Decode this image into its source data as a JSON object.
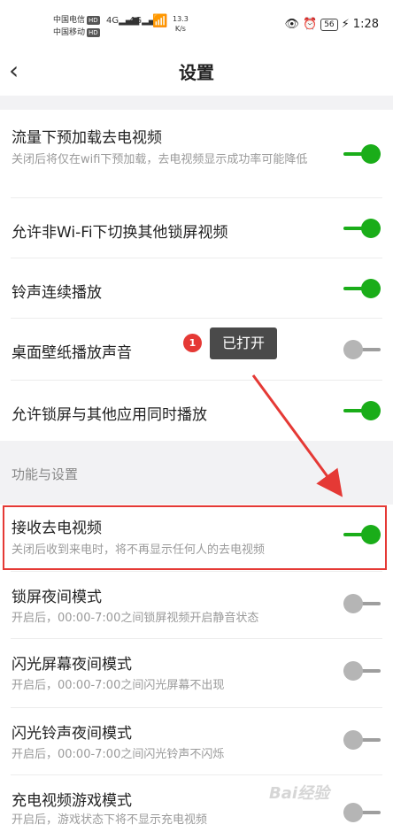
{
  "status": {
    "carrier1": "中国电信",
    "carrier2": "中国移动",
    "hd": "HD",
    "net": "4G",
    "speed_value": "13.3",
    "speed_unit": "K/s",
    "battery": "56",
    "time": "1:28"
  },
  "header": {
    "back_icon": "chevron-left-icon",
    "title": "设置"
  },
  "settings_top": [
    {
      "label": "流量下预加载去电视频",
      "desc": "关闭后将仅在wifi下预加载，去电视频显示成功率可能降低",
      "on": true
    },
    {
      "label": "允许非Wi-Fi下切换其他锁屏视频",
      "desc": "",
      "on": true
    },
    {
      "label": "铃声连续播放",
      "desc": "",
      "on": true
    },
    {
      "label": "桌面壁纸播放声音",
      "desc": "",
      "on": false
    },
    {
      "label": "允许锁屏与其他应用同时播放",
      "desc": "",
      "on": true
    }
  ],
  "section_title": "功能与设置",
  "settings_bottom": [
    {
      "label": "接收去电视频",
      "desc": "关闭后收到来电时，将不再显示任何人的去电视频",
      "on": true
    },
    {
      "label": "锁屏夜间模式",
      "desc": "开启后，00:00-7:00之间锁屏视频开启静音状态",
      "on": false
    },
    {
      "label": "闪光屏幕夜间模式",
      "desc": "开启后，00:00-7:00之间闪光屏幕不出现",
      "on": false
    },
    {
      "label": "闪光铃声夜间模式",
      "desc": "开启后，00:00-7:00之间闪光铃声不闪烁",
      "on": false
    },
    {
      "label": "充电视频游戏模式",
      "desc": "开启后，游戏状态下将不显示充电视频",
      "on": false
    }
  ],
  "annotation": {
    "badge": "1",
    "tooltip": "已打开"
  },
  "watermark": "Bai经验",
  "colors": {
    "toggle_on": "#1aad19",
    "toggle_off": "#b5b5b5",
    "highlight": "#e53935"
  }
}
